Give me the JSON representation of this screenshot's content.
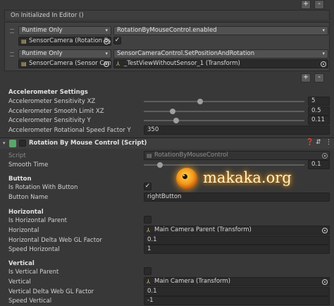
{
  "event_box": {
    "title": "On Initialized In Editor ()",
    "entries": [
      {
        "runtime": "Runtime Only",
        "target": "SensorCamera (Rotation By",
        "method": "RotationByMouseControl.enabled",
        "param_checked": true
      },
      {
        "runtime": "Runtime Only",
        "target": "SensorCamera (Sensor Can",
        "method": "SensorCameraControl.SetPositionAndRotation",
        "param": "_TestViewWithoutSensor_1 (Transform)"
      }
    ],
    "add_label": "+",
    "remove_label": "-"
  },
  "accelerometer": {
    "header": "Accelerometer Settings",
    "fields": [
      {
        "label": "Accelerometer Sensitivity XZ",
        "value": "5"
      },
      {
        "label": "Accelerometer Smooth Limit XZ",
        "value": "0.5"
      },
      {
        "label": "Accelerometer Sensitivity Y",
        "value": "0.11"
      },
      {
        "label": "Accelerometer Rotational Speed Factor Y",
        "value": "350"
      }
    ],
    "slider_fractions": [
      0.35,
      0.18,
      0.2
    ]
  },
  "component": {
    "title": "Rotation By Mouse Control (Script)",
    "script_label": "Script",
    "script_value": "RotationByMouseControl",
    "smooth_time_label": "Smooth Time",
    "smooth_time_value": "0.1",
    "smooth_time_fraction": 0.1
  },
  "watermark": "makaka.org",
  "button_section": {
    "header": "Button",
    "is_rotation_label": "Is Rotation With Button",
    "is_rotation_checked": true,
    "name_label": "Button Name",
    "name_value": "rightButton"
  },
  "horizontal": {
    "header": "Horizontal",
    "is_parent_label": "Is Horizontal Parent",
    "is_parent_checked": false,
    "horizontal_label": "Horizontal",
    "horizontal_value": "Main Camera Parent (Transform)",
    "delta_label": "Horizontal Delta Web GL Factor",
    "delta_value": "0.1",
    "speed_label": "Speed Horizontal",
    "speed_value": "1"
  },
  "vertical": {
    "header": "Vertical",
    "is_parent_label": "Is Vertical Parent",
    "is_parent_checked": false,
    "vertical_label": "Vertical",
    "vertical_value": "Main Camera (Transform)",
    "delta_label": "Vertical Delta Web GL Factor",
    "delta_value": "0.1",
    "speed_label": "Speed Vertical",
    "speed_value": "-1"
  },
  "icons": {
    "component": "script-icon",
    "help": "help-icon",
    "preset": "preset-icon",
    "menu": "kebab-menu-icon"
  }
}
